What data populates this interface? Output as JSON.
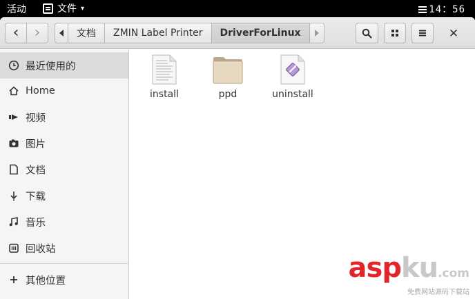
{
  "topbar": {
    "activities": "活动",
    "app_name": "文件",
    "app_menu_caret": "▾",
    "clock": "14：56"
  },
  "header": {
    "back_icon": "‹",
    "forward_icon": "›",
    "path_left_arrow": "‹",
    "path_right_arrow": "›",
    "breadcrumb": [
      "文档",
      "ZMIN Label Printer",
      "DriverForLinux"
    ],
    "active_segment": "DriverForLinux",
    "close_icon": "✕"
  },
  "sidebar": {
    "items": [
      {
        "label": "最近使用的",
        "icon": "clock-icon",
        "active": true
      },
      {
        "label": "Home",
        "icon": "home-icon"
      },
      {
        "label": "视频",
        "icon": "video-icon"
      },
      {
        "label": "图片",
        "icon": "camera-icon"
      },
      {
        "label": "文档",
        "icon": "document-icon"
      },
      {
        "label": "下载",
        "icon": "download-icon"
      },
      {
        "label": "音乐",
        "icon": "music-icon"
      },
      {
        "label": "回收站",
        "icon": "trash-icon"
      },
      {
        "label": "其他位置",
        "icon": "plus-icon"
      }
    ]
  },
  "files": [
    {
      "name": "install",
      "type": "text-file"
    },
    {
      "name": "ppd",
      "type": "folder"
    },
    {
      "name": "uninstall",
      "type": "script-file"
    }
  ],
  "watermark": {
    "brand_a": "asp",
    "brand_b": "ku",
    "brand_c": ".com",
    "tagline": "免费网站源码下载站"
  }
}
